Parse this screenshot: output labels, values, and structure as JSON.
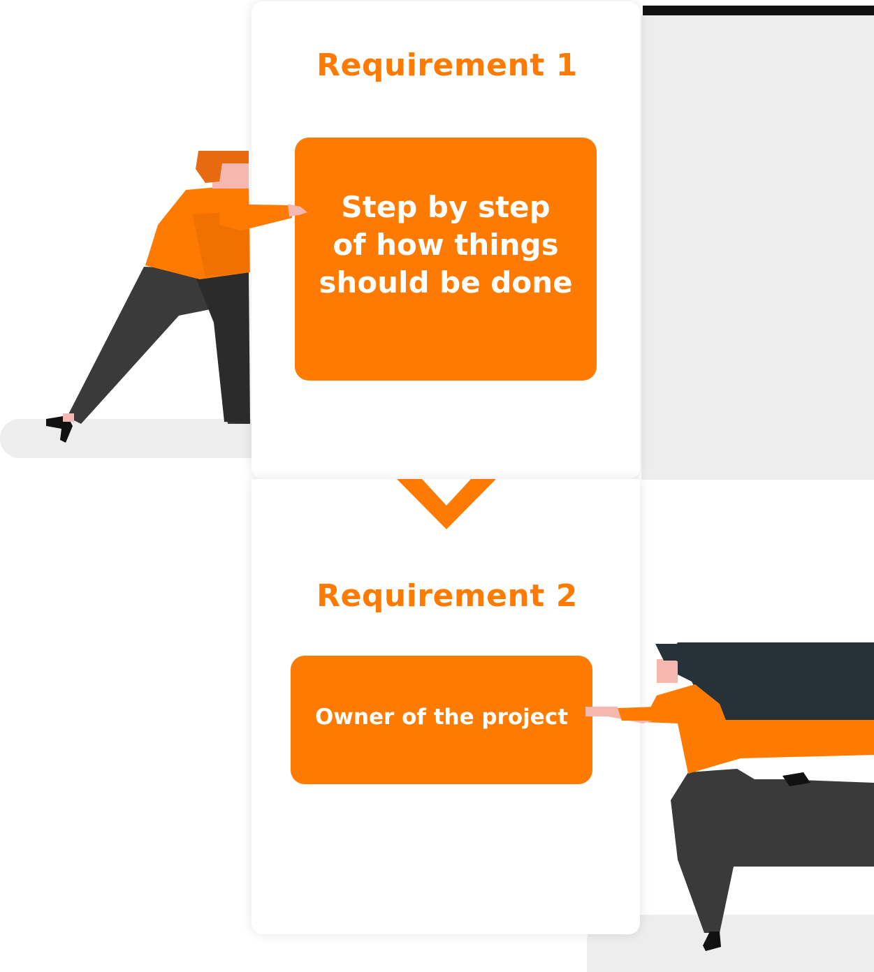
{
  "steps": [
    {
      "title": "Requirement 1",
      "description": "Step by step\nof how things\nshould be done"
    },
    {
      "title": "Requirement 2",
      "description": "Owner of the project"
    }
  ],
  "colors": {
    "accent": "#ff7a00",
    "pants": "#3a3a3a",
    "hair_dark": "#263238",
    "skin": "#f4b8b0"
  },
  "icons": [
    "arrow-down-icon",
    "person-pushing-illustration",
    "person-pulling-illustration"
  ]
}
